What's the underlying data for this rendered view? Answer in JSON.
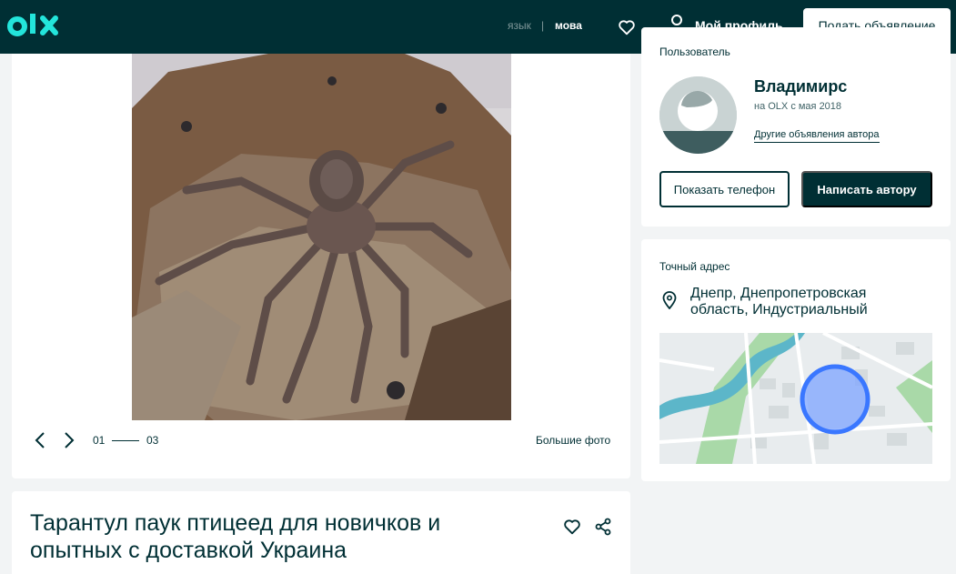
{
  "header": {
    "logo_text": "OLX",
    "lang_ru": "язык",
    "lang_separator": "|",
    "lang_uk": "мова",
    "profile_label": "Мой профиль",
    "post_ad_label": "Подать объявление"
  },
  "gallery": {
    "current_photo": "01",
    "total_photos": "03",
    "bigger_photos_label": "Большие фото"
  },
  "ad": {
    "title": "Тарантул паук птицеед для новичков и опытных с доставкой Украина"
  },
  "user": {
    "caption": "Пользователь",
    "name": "Владимирс",
    "since": "на OLX с мая 2018",
    "other_ads_label": "Другие объявления автора",
    "show_phone_label": "Показать телефон",
    "message_label": "Написать автору"
  },
  "address": {
    "caption": "Точный адрес",
    "location": "Днепр, Днепропетровская область, Индустриальный"
  },
  "colors": {
    "brand_dark": "#002f34",
    "background": "#f2f4f5",
    "logo_teal": "#23e5db",
    "map_marker": "#3a77ff"
  }
}
